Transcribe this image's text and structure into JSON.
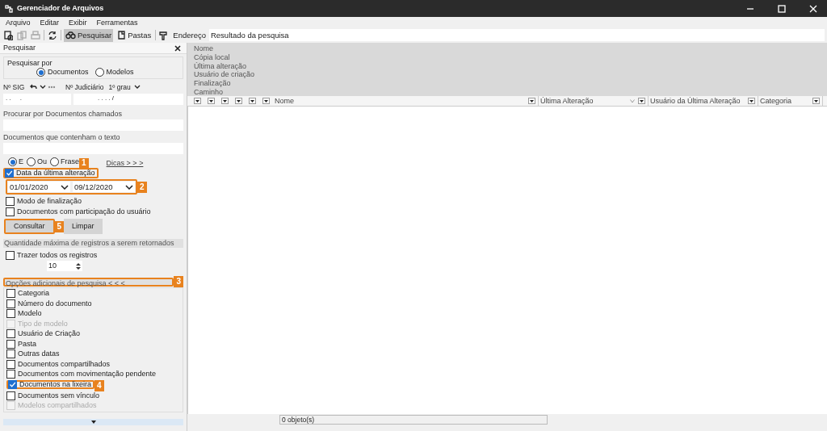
{
  "window": {
    "title": "Gerenciador de Arquivos"
  },
  "menu": [
    "Arquivo",
    "Editar",
    "Exibir",
    "Ferramentas"
  ],
  "toolbar": {
    "buttons": [
      {
        "kind": "new",
        "disabled": false
      },
      {
        "kind": "copy",
        "disabled": true
      },
      {
        "kind": "print",
        "disabled": true
      },
      {
        "kind": "refresh",
        "disabled": false
      }
    ],
    "tabs": [
      {
        "label": "Pesquisar",
        "selected": true,
        "kind": "search"
      },
      {
        "label": "Pastas",
        "selected": false,
        "kind": "folder"
      }
    ],
    "address_label": "Endereço",
    "address": "Resultado da pesquisa"
  },
  "search_panel": {
    "title": "Pesquisar",
    "search_by": {
      "label": "Pesquisar por",
      "options": [
        {
          "label": "Documentos",
          "selected": true
        },
        {
          "label": "Modelos",
          "selected": false
        }
      ]
    },
    "sig_label": "Nº SIG",
    "sig_value": ". .     .",
    "judicial_label": "Nº Judiciário",
    "degree": "1º grau",
    "judicial_value": ". . . . /",
    "name_label": "Procurar por Documentos chamados",
    "text_label": "Documentos que contenham o texto",
    "text_modes": [
      {
        "label": "E",
        "selected": true
      },
      {
        "label": "Ou",
        "selected": false
      },
      {
        "label": "Frase",
        "selected": false
      }
    ],
    "tips_link": "Dicas > > >",
    "date_filter": {
      "label": "Data da última alteração",
      "checked": true,
      "callout": "1"
    },
    "dates": {
      "from": "01/01/2020",
      "to": "09/12/2020",
      "callout": "2"
    },
    "options": [
      {
        "label": "Modo de finalização",
        "checked": false
      },
      {
        "label": "Documentos com participação do usuário",
        "checked": false
      }
    ],
    "buttons": [
      {
        "label": "Consultar",
        "callout": "5"
      },
      {
        "label": "Limpar"
      }
    ],
    "max_section": "Quantidade máxima de registros a serem retornados",
    "all_records": {
      "label": "Trazer todos os registros",
      "checked": false
    },
    "max_count": "10",
    "additional": {
      "title": "Opções adicionais de pesquisa < < <",
      "callout": "3"
    },
    "additional_options": [
      {
        "label": "Categoria",
        "checked": false,
        "disabled": false
      },
      {
        "label": "Número do documento",
        "checked": false,
        "disabled": false
      },
      {
        "label": "Modelo",
        "checked": false,
        "disabled": false
      },
      {
        "label": "Tipo de modelo",
        "checked": false,
        "disabled": true
      },
      {
        "label": "Usuário de Criação",
        "checked": false,
        "disabled": false
      },
      {
        "label": "Pasta",
        "checked": false,
        "disabled": false
      },
      {
        "label": "Outras datas",
        "checked": false,
        "disabled": false
      },
      {
        "label": "Documentos compartilhados",
        "checked": false,
        "disabled": false
      },
      {
        "label": "Documentos com movimentação pendente",
        "checked": false,
        "disabled": false
      },
      {
        "label": "Documentos na lixeira",
        "checked": true,
        "disabled": false,
        "callout": "4"
      },
      {
        "label": "Documentos sem vínculo",
        "checked": false,
        "disabled": false
      },
      {
        "label": "Modelos compartilhados",
        "checked": false,
        "disabled": true
      }
    ]
  },
  "column_chooser": [
    "Nome",
    "Cópia local",
    "Última alteração",
    "Usuário de criação",
    "Finalização",
    "Caminho"
  ],
  "table": {
    "columns": [
      {
        "label": "Nome",
        "sorted": false
      },
      {
        "label": "Última Alteração",
        "sorted": true
      },
      {
        "label": "Usuário da Última Alteração",
        "sorted": false
      },
      {
        "label": "Categoria",
        "sorted": false
      }
    ]
  },
  "status_bar": "0 objeto(s)"
}
